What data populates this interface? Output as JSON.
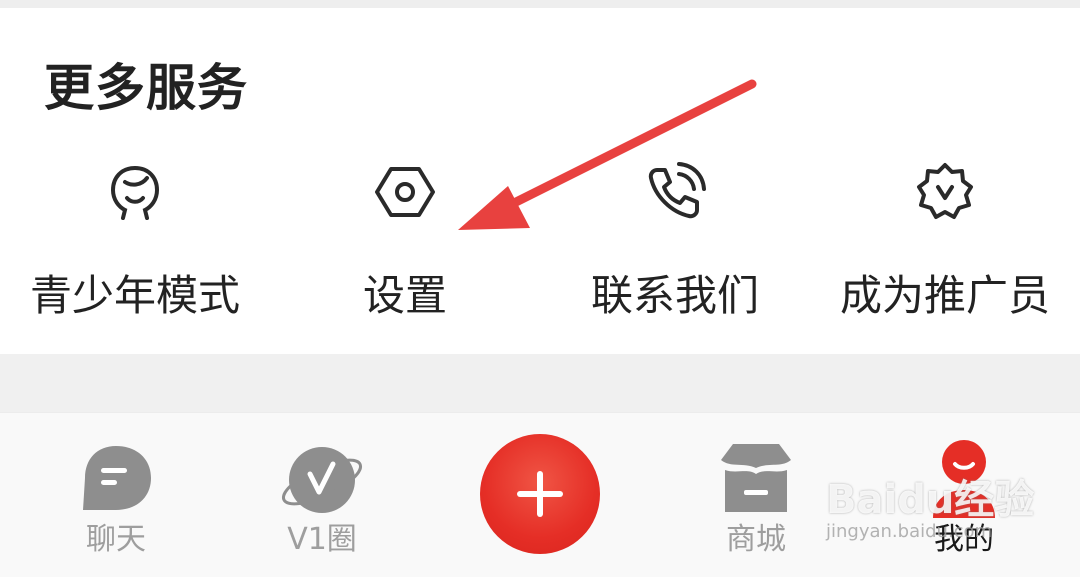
{
  "more_services": {
    "title": "更多服务",
    "items": [
      {
        "label": "青少年模式",
        "icon": "teen-face-icon"
      },
      {
        "label": "设置",
        "icon": "settings-hex-icon"
      },
      {
        "label": "联系我们",
        "icon": "phone-call-icon"
      },
      {
        "label": "成为推广员",
        "icon": "promoter-badge-icon"
      }
    ]
  },
  "tab_bar": {
    "tabs": [
      {
        "label": "聊天",
        "icon": "chat-bubble-icon",
        "active": false
      },
      {
        "label": "V1圈",
        "icon": "v1-planet-icon",
        "active": false
      },
      {
        "label": "",
        "icon": "plus-icon",
        "active": false
      },
      {
        "label": "商城",
        "icon": "store-box-icon",
        "active": false
      },
      {
        "label": "我的",
        "icon": "profile-icon",
        "active": true
      }
    ]
  },
  "annotation": {
    "icon": "red-arrow-pointer"
  },
  "watermark": {
    "brand": "Baidu经验",
    "url": "jingyan.baidu.com"
  },
  "colors": {
    "accent": "#e52e26",
    "arrow": "#e8413f",
    "icon_dark": "#2a2a2a",
    "tab_inactive_icon": "#8e8e8e",
    "text": "#222222"
  }
}
